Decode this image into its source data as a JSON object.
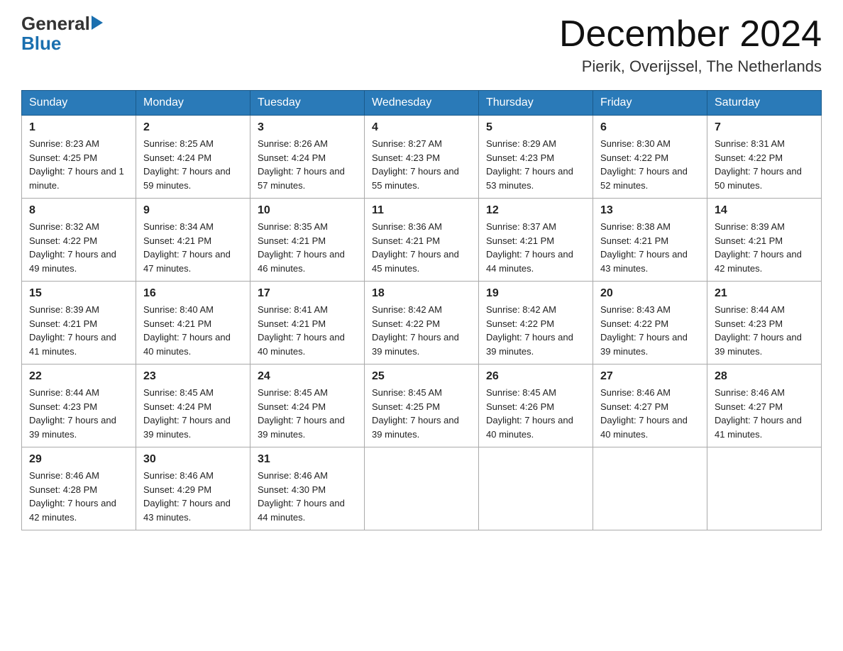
{
  "header": {
    "logo_general": "General",
    "logo_blue": "Blue",
    "month_title": "December 2024",
    "location": "Pierik, Overijssel, The Netherlands"
  },
  "days_of_week": [
    "Sunday",
    "Monday",
    "Tuesday",
    "Wednesday",
    "Thursday",
    "Friday",
    "Saturday"
  ],
  "weeks": [
    [
      {
        "day": "1",
        "sunrise": "8:23 AM",
        "sunset": "4:25 PM",
        "daylight": "7 hours and 1 minute."
      },
      {
        "day": "2",
        "sunrise": "8:25 AM",
        "sunset": "4:24 PM",
        "daylight": "7 hours and 59 minutes."
      },
      {
        "day": "3",
        "sunrise": "8:26 AM",
        "sunset": "4:24 PM",
        "daylight": "7 hours and 57 minutes."
      },
      {
        "day": "4",
        "sunrise": "8:27 AM",
        "sunset": "4:23 PM",
        "daylight": "7 hours and 55 minutes."
      },
      {
        "day": "5",
        "sunrise": "8:29 AM",
        "sunset": "4:23 PM",
        "daylight": "7 hours and 53 minutes."
      },
      {
        "day": "6",
        "sunrise": "8:30 AM",
        "sunset": "4:22 PM",
        "daylight": "7 hours and 52 minutes."
      },
      {
        "day": "7",
        "sunrise": "8:31 AM",
        "sunset": "4:22 PM",
        "daylight": "7 hours and 50 minutes."
      }
    ],
    [
      {
        "day": "8",
        "sunrise": "8:32 AM",
        "sunset": "4:22 PM",
        "daylight": "7 hours and 49 minutes."
      },
      {
        "day": "9",
        "sunrise": "8:34 AM",
        "sunset": "4:21 PM",
        "daylight": "7 hours and 47 minutes."
      },
      {
        "day": "10",
        "sunrise": "8:35 AM",
        "sunset": "4:21 PM",
        "daylight": "7 hours and 46 minutes."
      },
      {
        "day": "11",
        "sunrise": "8:36 AM",
        "sunset": "4:21 PM",
        "daylight": "7 hours and 45 minutes."
      },
      {
        "day": "12",
        "sunrise": "8:37 AM",
        "sunset": "4:21 PM",
        "daylight": "7 hours and 44 minutes."
      },
      {
        "day": "13",
        "sunrise": "8:38 AM",
        "sunset": "4:21 PM",
        "daylight": "7 hours and 43 minutes."
      },
      {
        "day": "14",
        "sunrise": "8:39 AM",
        "sunset": "4:21 PM",
        "daylight": "7 hours and 42 minutes."
      }
    ],
    [
      {
        "day": "15",
        "sunrise": "8:39 AM",
        "sunset": "4:21 PM",
        "daylight": "7 hours and 41 minutes."
      },
      {
        "day": "16",
        "sunrise": "8:40 AM",
        "sunset": "4:21 PM",
        "daylight": "7 hours and 40 minutes."
      },
      {
        "day": "17",
        "sunrise": "8:41 AM",
        "sunset": "4:21 PM",
        "daylight": "7 hours and 40 minutes."
      },
      {
        "day": "18",
        "sunrise": "8:42 AM",
        "sunset": "4:22 PM",
        "daylight": "7 hours and 39 minutes."
      },
      {
        "day": "19",
        "sunrise": "8:42 AM",
        "sunset": "4:22 PM",
        "daylight": "7 hours and 39 minutes."
      },
      {
        "day": "20",
        "sunrise": "8:43 AM",
        "sunset": "4:22 PM",
        "daylight": "7 hours and 39 minutes."
      },
      {
        "day": "21",
        "sunrise": "8:44 AM",
        "sunset": "4:23 PM",
        "daylight": "7 hours and 39 minutes."
      }
    ],
    [
      {
        "day": "22",
        "sunrise": "8:44 AM",
        "sunset": "4:23 PM",
        "daylight": "7 hours and 39 minutes."
      },
      {
        "day": "23",
        "sunrise": "8:45 AM",
        "sunset": "4:24 PM",
        "daylight": "7 hours and 39 minutes."
      },
      {
        "day": "24",
        "sunrise": "8:45 AM",
        "sunset": "4:24 PM",
        "daylight": "7 hours and 39 minutes."
      },
      {
        "day": "25",
        "sunrise": "8:45 AM",
        "sunset": "4:25 PM",
        "daylight": "7 hours and 39 minutes."
      },
      {
        "day": "26",
        "sunrise": "8:45 AM",
        "sunset": "4:26 PM",
        "daylight": "7 hours and 40 minutes."
      },
      {
        "day": "27",
        "sunrise": "8:46 AM",
        "sunset": "4:27 PM",
        "daylight": "7 hours and 40 minutes."
      },
      {
        "day": "28",
        "sunrise": "8:46 AM",
        "sunset": "4:27 PM",
        "daylight": "7 hours and 41 minutes."
      }
    ],
    [
      {
        "day": "29",
        "sunrise": "8:46 AM",
        "sunset": "4:28 PM",
        "daylight": "7 hours and 42 minutes."
      },
      {
        "day": "30",
        "sunrise": "8:46 AM",
        "sunset": "4:29 PM",
        "daylight": "7 hours and 43 minutes."
      },
      {
        "day": "31",
        "sunrise": "8:46 AM",
        "sunset": "4:30 PM",
        "daylight": "7 hours and 44 minutes."
      },
      null,
      null,
      null,
      null
    ]
  ],
  "labels": {
    "sunrise": "Sunrise:",
    "sunset": "Sunset:",
    "daylight": "Daylight:"
  }
}
